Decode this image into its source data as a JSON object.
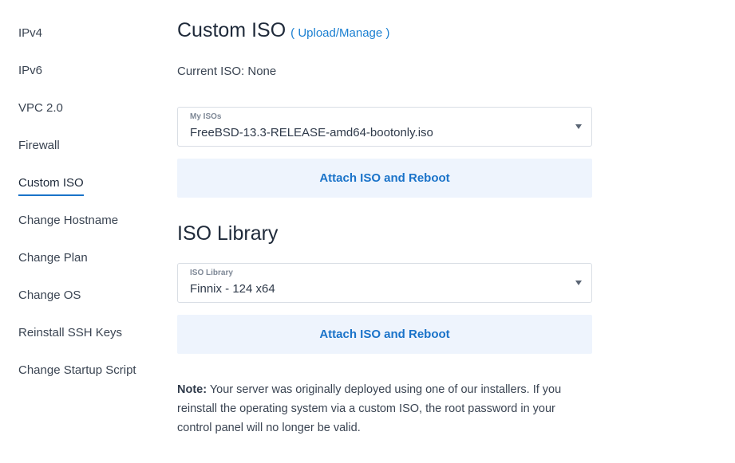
{
  "sidebar": {
    "items": [
      {
        "label": "IPv4"
      },
      {
        "label": "IPv6"
      },
      {
        "label": "VPC 2.0"
      },
      {
        "label": "Firewall"
      },
      {
        "label": "Custom ISO",
        "active": true
      },
      {
        "label": "Change Hostname"
      },
      {
        "label": "Change Plan"
      },
      {
        "label": "Change OS"
      },
      {
        "label": "Reinstall SSH Keys"
      },
      {
        "label": "Change Startup Script"
      }
    ]
  },
  "custom_iso": {
    "title": "Custom ISO",
    "link": "( Upload/Manage )",
    "current": "Current ISO: None",
    "select_label": "My ISOs",
    "select_value": "FreeBSD-13.3-RELEASE-amd64-bootonly.iso",
    "button": "Attach ISO and Reboot"
  },
  "iso_library": {
    "title": "ISO Library",
    "select_label": "ISO Library",
    "select_value": "Finnix - 124 x64",
    "button": "Attach ISO and Reboot"
  },
  "note": {
    "label": "Note:",
    "text": " Your server was originally deployed using one of our installers. If you reinstall the operating system via a custom ISO, the root password in your control panel will no longer be valid."
  },
  "colors": {
    "accent": "#1a73c9",
    "button_bg": "#eef4fd"
  }
}
